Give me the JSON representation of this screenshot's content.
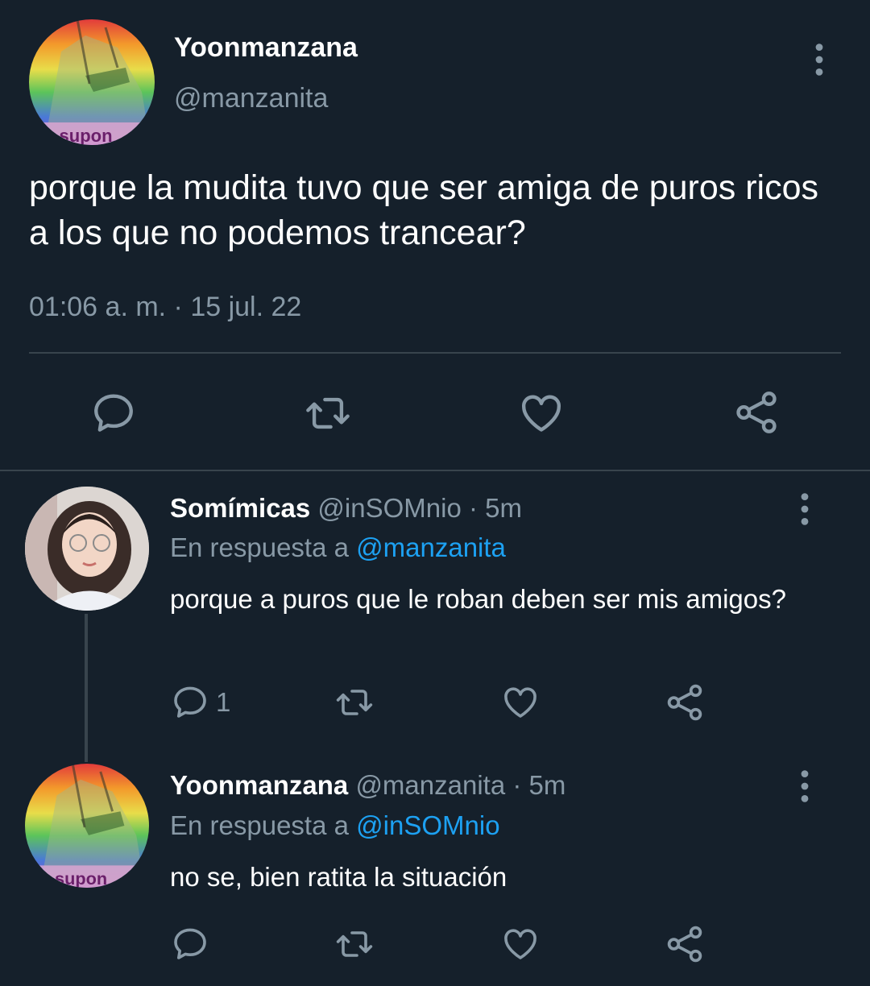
{
  "main_tweet": {
    "display_name": "Yoonmanzana",
    "handle": "@manzanita",
    "text": "porque la mudita tuvo que ser amiga de puros ricos a los que no podemos trancear?",
    "timestamp": "01:06 a. m. · 15 jul. 22",
    "avatar_caption": "o supon"
  },
  "replies": [
    {
      "display_name": "Somímicas",
      "handle": "@inSOMnio",
      "time": "· 5m",
      "reply_prefix": "En respuesta a",
      "reply_to": "@manzanita",
      "text": "porque a puros que le roban deben ser mis amigos?",
      "reply_count": "1"
    },
    {
      "display_name": "Yoonmanzana",
      "handle": "@manzanita",
      "time": "· 5m",
      "reply_prefix": "En respuesta a",
      "reply_to": "@inSOMnio",
      "text": "no se, bien ratita la situación",
      "avatar_caption": "o supon"
    }
  ],
  "icons": [
    "reply-icon",
    "retweet-icon",
    "like-icon",
    "share-icon",
    "more-vertical-icon"
  ],
  "colors": {
    "background": "#15202b",
    "text": "#ffffff",
    "secondary": "#8899a6",
    "divider": "#38444d",
    "link": "#1da1f2"
  }
}
